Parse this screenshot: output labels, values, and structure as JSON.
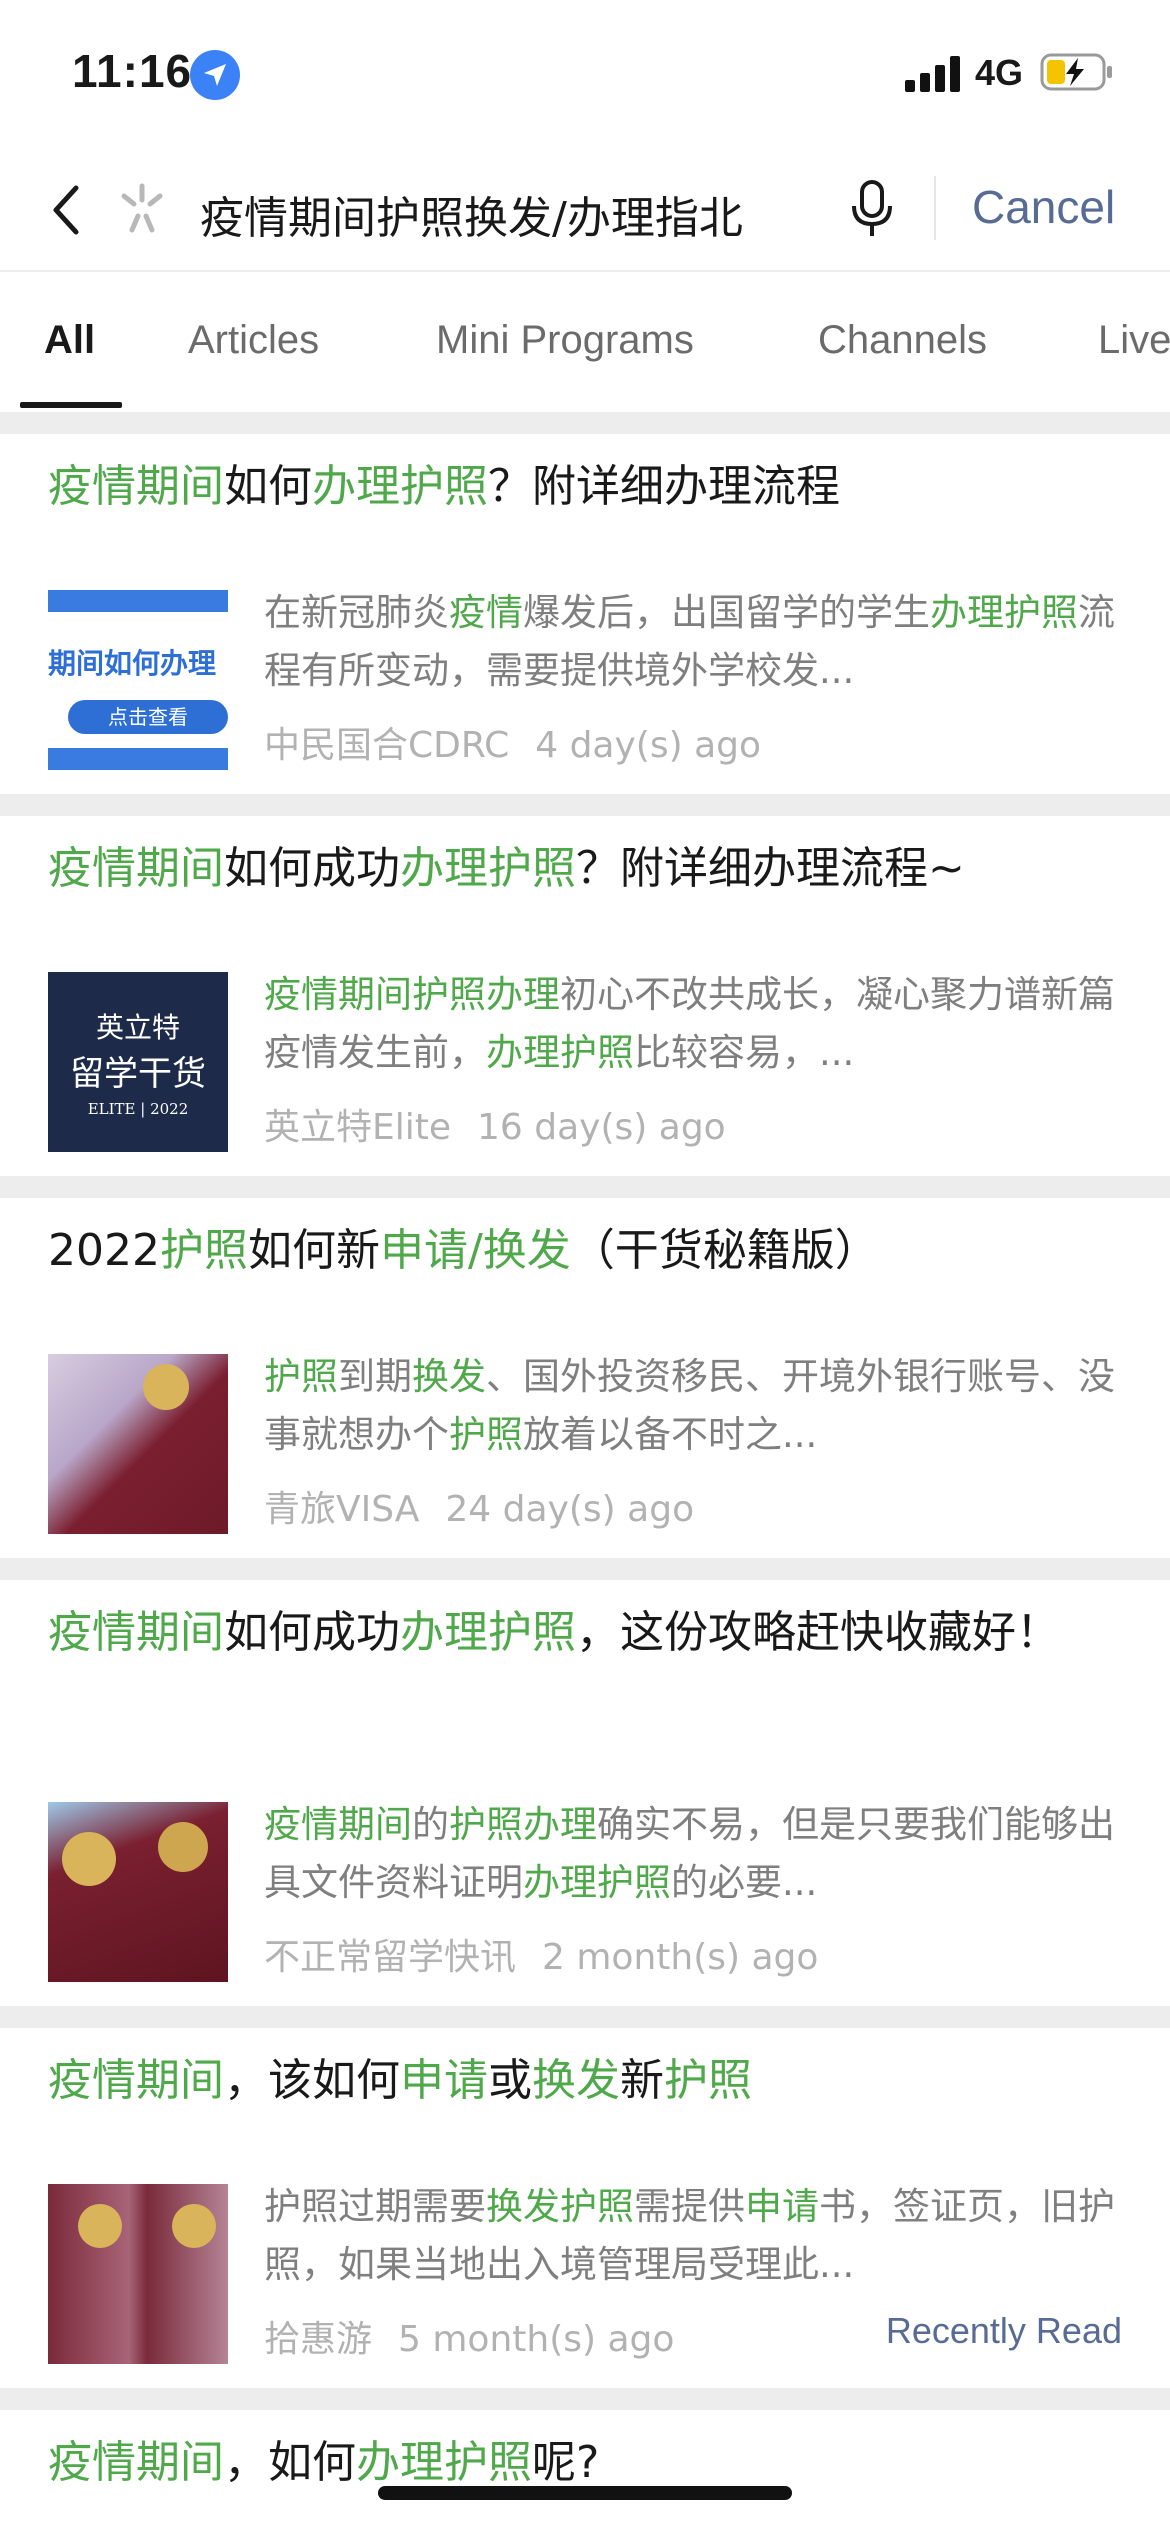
{
  "status_bar": {
    "time": "11:16",
    "network": "4G"
  },
  "search": {
    "query": "疫情期间护照换发/办理指北",
    "cancel_label": "Cancel"
  },
  "tabs": [
    {
      "label": "All",
      "active": true
    },
    {
      "label": "Articles",
      "active": false
    },
    {
      "label": "Mini Programs",
      "active": false
    },
    {
      "label": "Channels",
      "active": false
    },
    {
      "label": "Live",
      "active": false
    }
  ],
  "results": [
    {
      "title": [
        {
          "t": "疫情期间",
          "h": true
        },
        {
          "t": "如何",
          "h": false
        },
        {
          "t": "办理护照",
          "h": true
        },
        {
          "t": "？附详细办理流程",
          "h": false
        }
      ],
      "snippet": [
        {
          "t": "在新冠肺炎",
          "h": false
        },
        {
          "t": "疫情",
          "h": true
        },
        {
          "t": "爆发后，出国留学的学生",
          "h": false
        },
        {
          "t": "办理护照",
          "h": true
        },
        {
          "t": "流程有所变动，需要提供境外学校发...",
          "h": false
        }
      ],
      "source": "中民国合CDRC",
      "time": "4 day(s) ago",
      "thumb_text": "期间如何办理",
      "thumb_button": "点击查看"
    },
    {
      "title": [
        {
          "t": "疫情期间",
          "h": true
        },
        {
          "t": "如何成功",
          "h": false
        },
        {
          "t": "办理护照",
          "h": true
        },
        {
          "t": "？附详细办理流程~",
          "h": false
        }
      ],
      "snippet": [
        {
          "t": "疫情期间护照办理",
          "h": true
        },
        {
          "t": "初心不改共成长，凝心聚力谱新篇疫情发生前，",
          "h": false
        },
        {
          "t": "办理护照",
          "h": true
        },
        {
          "t": "比较容易，...",
          "h": false
        }
      ],
      "source": "英立特Elite",
      "time": "16 day(s) ago",
      "thumb_line1": "英立特",
      "thumb_line2": "留学干货",
      "thumb_line3": "ELITE | 2022"
    },
    {
      "title": [
        {
          "t": "2022",
          "h": false
        },
        {
          "t": "护照",
          "h": true
        },
        {
          "t": "如何新",
          "h": false
        },
        {
          "t": "申请/换发",
          "h": true
        },
        {
          "t": "（干货秘籍版）",
          "h": false
        }
      ],
      "snippet": [
        {
          "t": "护照",
          "h": true
        },
        {
          "t": "到期",
          "h": false
        },
        {
          "t": "换发",
          "h": true
        },
        {
          "t": "、国外投资移民、开境外银行账号、没事就想办个",
          "h": false
        },
        {
          "t": "护照",
          "h": true
        },
        {
          "t": "放着以备不时之...",
          "h": false
        }
      ],
      "source": "青旅VISA",
      "time": "24 day(s) ago"
    },
    {
      "title": [
        {
          "t": "疫情期间",
          "h": true
        },
        {
          "t": "如何成功",
          "h": false
        },
        {
          "t": "办理护照",
          "h": true
        },
        {
          "t": "，这份攻略赶快收藏好！",
          "h": false
        }
      ],
      "snippet": [
        {
          "t": "疫情期间",
          "h": true
        },
        {
          "t": "的",
          "h": false
        },
        {
          "t": "护照办理",
          "h": true
        },
        {
          "t": "确实不易，但是只要我们能够出具文件资料证明",
          "h": false
        },
        {
          "t": "办理护照",
          "h": true
        },
        {
          "t": "的必要...",
          "h": false
        }
      ],
      "source": "不正常留学快讯",
      "time": "2 month(s) ago"
    },
    {
      "title": [
        {
          "t": "疫情期间",
          "h": true
        },
        {
          "t": "，该如何",
          "h": false
        },
        {
          "t": "申请",
          "h": true
        },
        {
          "t": "或",
          "h": false
        },
        {
          "t": "换发",
          "h": true
        },
        {
          "t": "新",
          "h": false
        },
        {
          "t": "护照",
          "h": true
        }
      ],
      "snippet": [
        {
          "t": "护照过期需要",
          "h": false
        },
        {
          "t": "换发护照",
          "h": true
        },
        {
          "t": "需提供",
          "h": false
        },
        {
          "t": "申请",
          "h": true
        },
        {
          "t": "书，签证页，旧护照，如果当地出入境管理局受理此...",
          "h": false
        }
      ],
      "source": "拾惠游",
      "time": "5 month(s) ago",
      "badge": "Recently Read"
    },
    {
      "title": [
        {
          "t": "疫情期间",
          "h": true
        },
        {
          "t": "，如何",
          "h": false
        },
        {
          "t": "办理护照",
          "h": true
        },
        {
          "t": "呢?",
          "h": false
        }
      ]
    }
  ],
  "colors": {
    "highlight": "#4fa84a",
    "link": "#576b95",
    "separator": "#ededed"
  }
}
